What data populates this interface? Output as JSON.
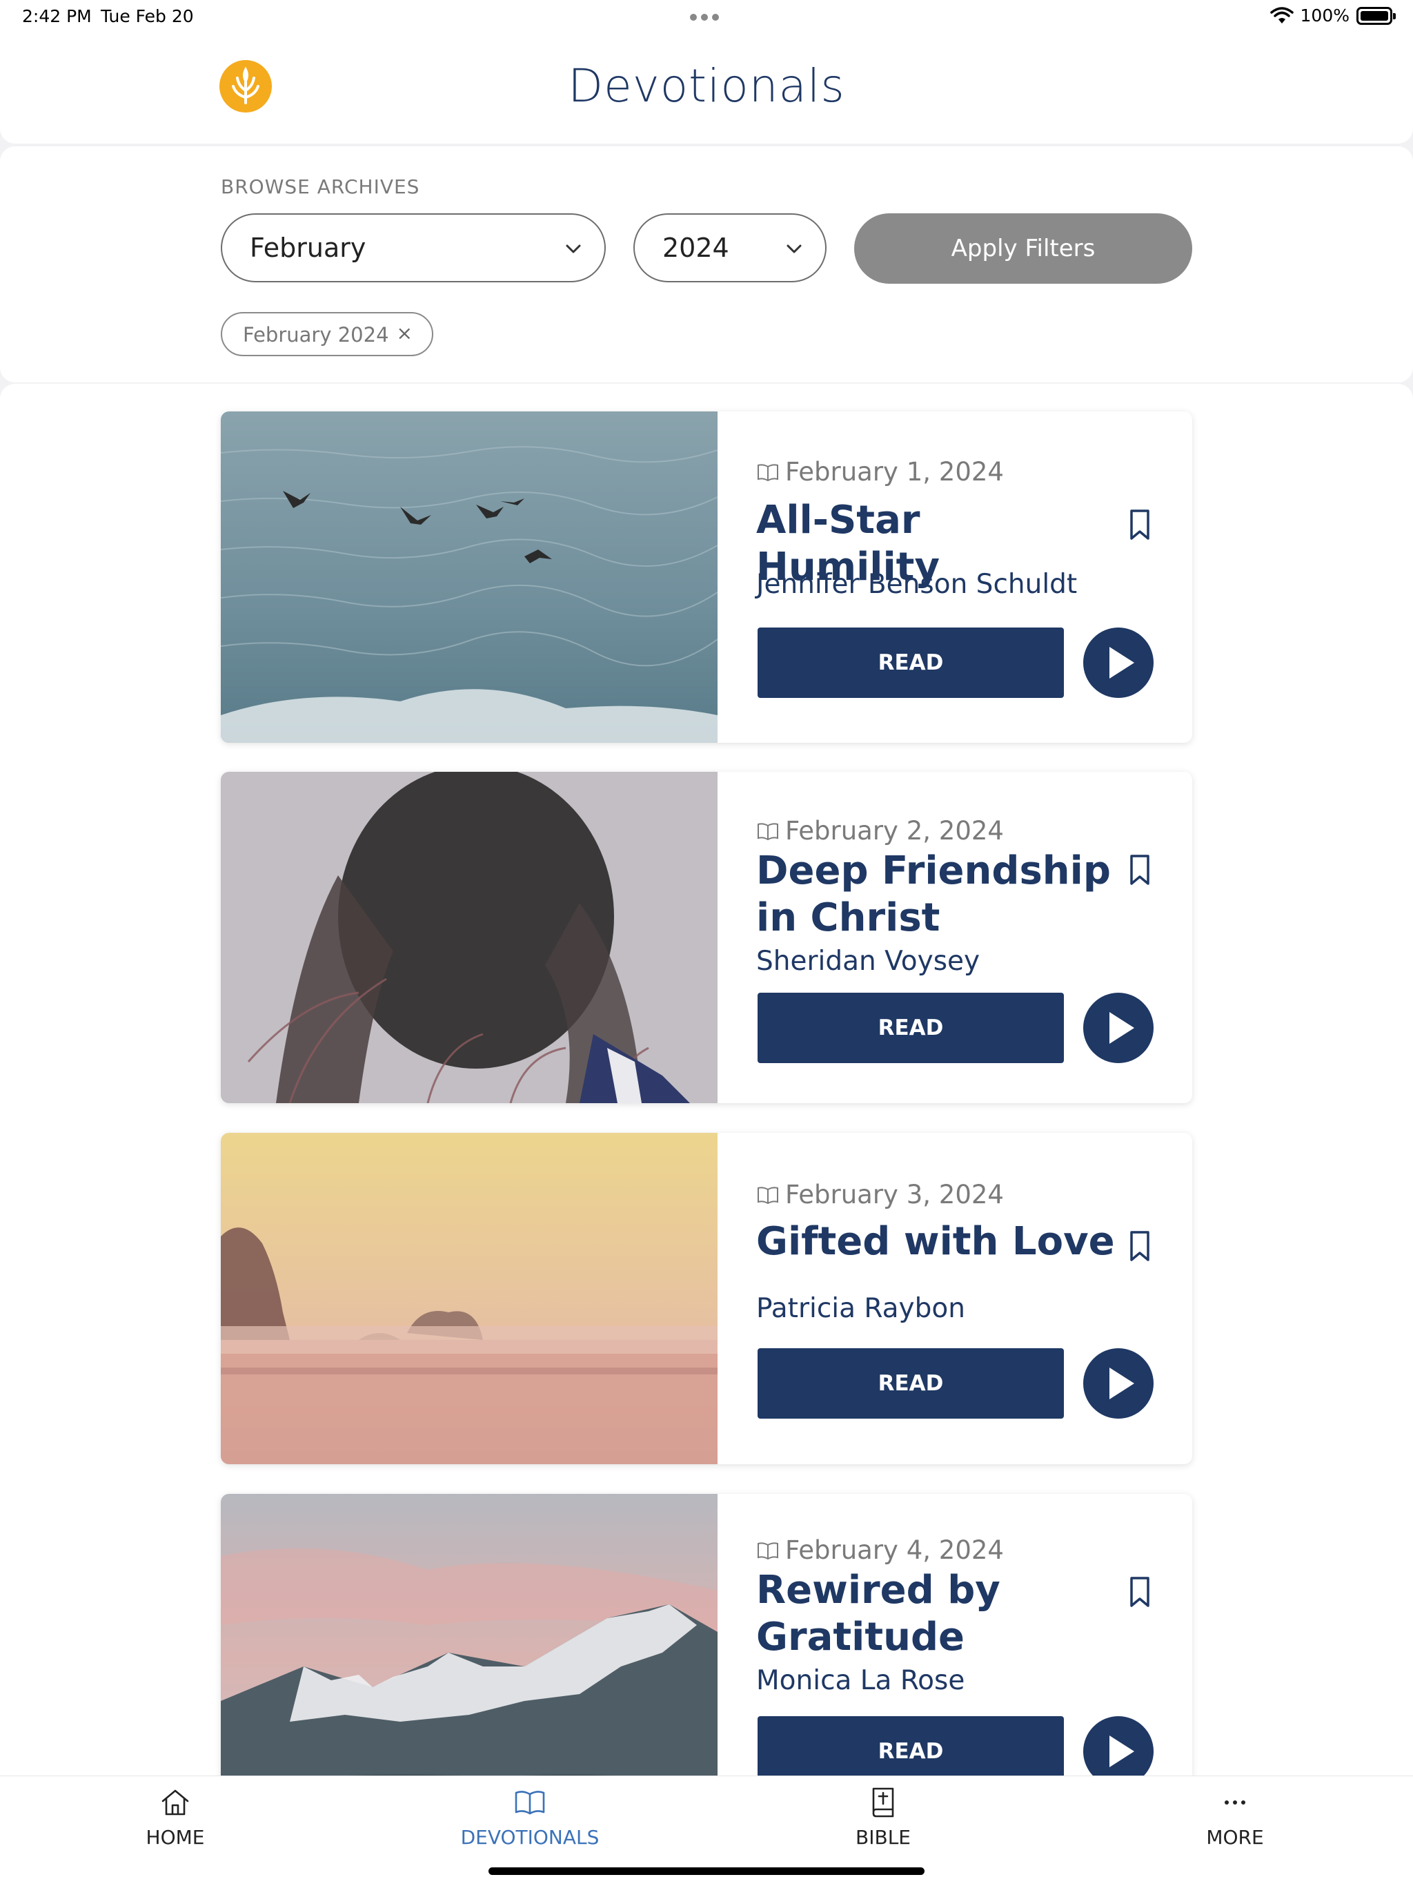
{
  "status_bar": {
    "time": "2:42 PM",
    "date": "Tue Feb 20",
    "battery": "100%"
  },
  "header": {
    "title": "Devotionals",
    "logo_icon": "wheat-logo-icon"
  },
  "filters": {
    "browse_label": "BROWSE ARCHIVES",
    "month_value": "February",
    "year_value": "2024",
    "apply_label": "Apply Filters",
    "active_chip": "February 2024",
    "chip_remove": "×"
  },
  "devotionals": [
    {
      "date": "February 1, 2024",
      "title": "All-Star Humility",
      "author": "Jennifer Benson Schuldt",
      "read_label": "READ",
      "image": "sea-with-birds"
    },
    {
      "date": "February 2, 2024",
      "title": "Deep Friendship in Christ",
      "author": "Sheridan Voysey",
      "read_label": "READ",
      "image": "person-hair-wind"
    },
    {
      "date": "February 3, 2024",
      "title": "Gifted with Love",
      "author": "Patricia Raybon",
      "read_label": "READ",
      "image": "misty-sunrise-field"
    },
    {
      "date": "February 4, 2024",
      "title": "Rewired by Gratitude",
      "author": "Monica La Rose",
      "read_label": "READ",
      "image": "snowy-mountains"
    }
  ],
  "tabbar": {
    "items": [
      {
        "label": "HOME",
        "icon": "home-icon"
      },
      {
        "label": "DEVOTIONALS",
        "icon": "open-book-icon"
      },
      {
        "label": "BIBLE",
        "icon": "bible-icon"
      },
      {
        "label": "MORE",
        "icon": "more-dots-icon"
      }
    ],
    "active": "DEVOTIONALS"
  },
  "colors": {
    "primary_navy": "#1f3864",
    "logo_orange": "#f5ab1e",
    "active_tab_blue": "#3b72b8",
    "disabled_button_gray": "#8a8a8a"
  }
}
